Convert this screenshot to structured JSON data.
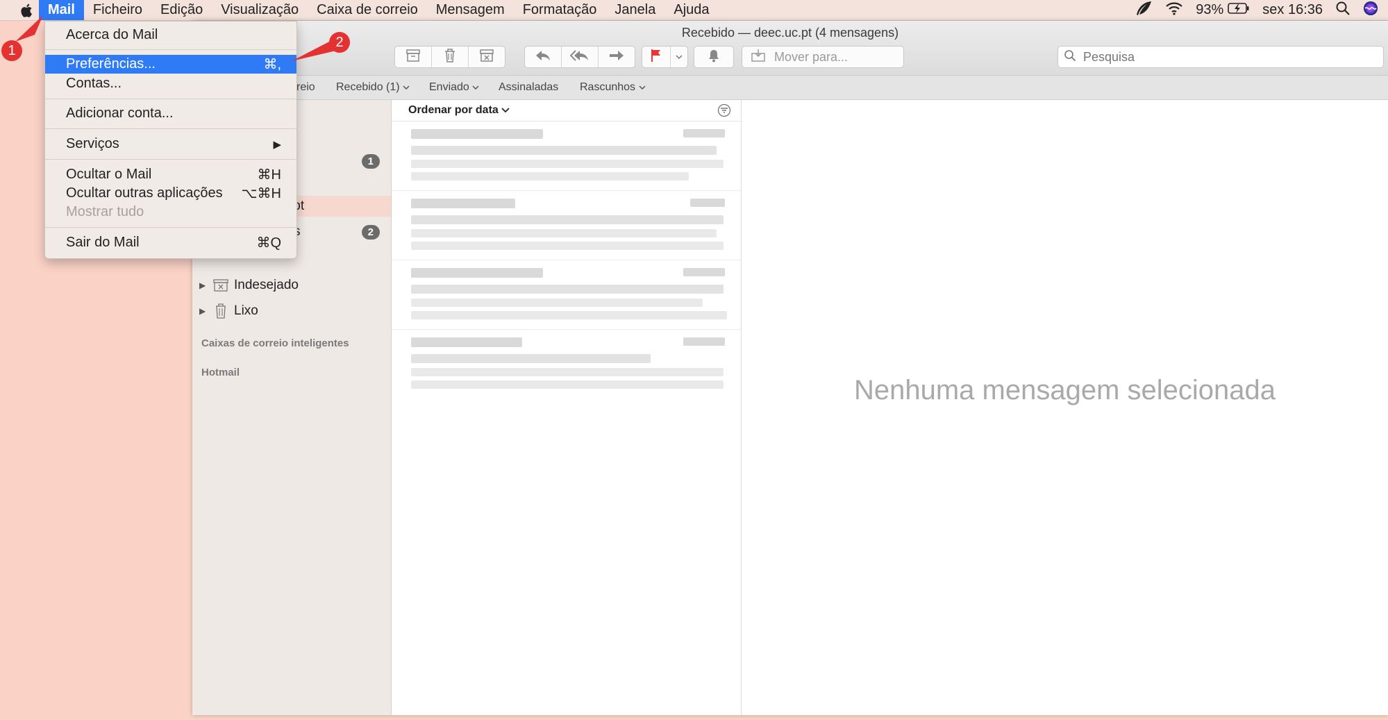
{
  "menubar": {
    "items": [
      "Mail",
      "Ficheiro",
      "Edição",
      "Visualização",
      "Caixa de correio",
      "Mensagem",
      "Formatação",
      "Janela",
      "Ajuda"
    ],
    "battery": "93%",
    "clock": "sex 16:36"
  },
  "mail_menu": {
    "about": "Acerca do Mail",
    "preferences": "Preferências...",
    "preferences_shortcut": "⌘,",
    "accounts": "Contas...",
    "add_account": "Adicionar conta...",
    "services": "Serviços",
    "hide": "Ocultar o Mail",
    "hide_shortcut": "⌘H",
    "hide_others": "Ocultar outras aplicações",
    "hide_others_shortcut": "⌥⌘H",
    "show_all": "Mostrar tudo",
    "quit": "Sair do Mail",
    "quit_shortcut": "⌘Q"
  },
  "window": {
    "title": "Recebido — deec.uc.pt (4 mensagens)",
    "move_to": "Mover para...",
    "search_placeholder": "Pesquisa"
  },
  "favorites": {
    "mailboxes_partial": "reio",
    "inbox": "Recebido (1)",
    "sent": "Enviado",
    "flagged": "Assinaladas",
    "drafts": "Rascunhos"
  },
  "sidebar": {
    "inbox_badge": "1",
    "account_partial": ".pt",
    "drafts_partial": "s",
    "drafts_badge": "2",
    "junk": "Indesejado",
    "trash": "Lixo",
    "smart_section": "Caixas de correio inteligentes",
    "hotmail_section": "Hotmail"
  },
  "message_list": {
    "sort_label": "Ordenar por data"
  },
  "preview": {
    "empty": "Nenhuma mensagem selecionada"
  },
  "annotations": {
    "marker_1": "1",
    "marker_2": "2",
    "color": "#e43131"
  },
  "colors": {
    "accent": "#2f7bf6",
    "desktop": "#fbd3c6"
  }
}
